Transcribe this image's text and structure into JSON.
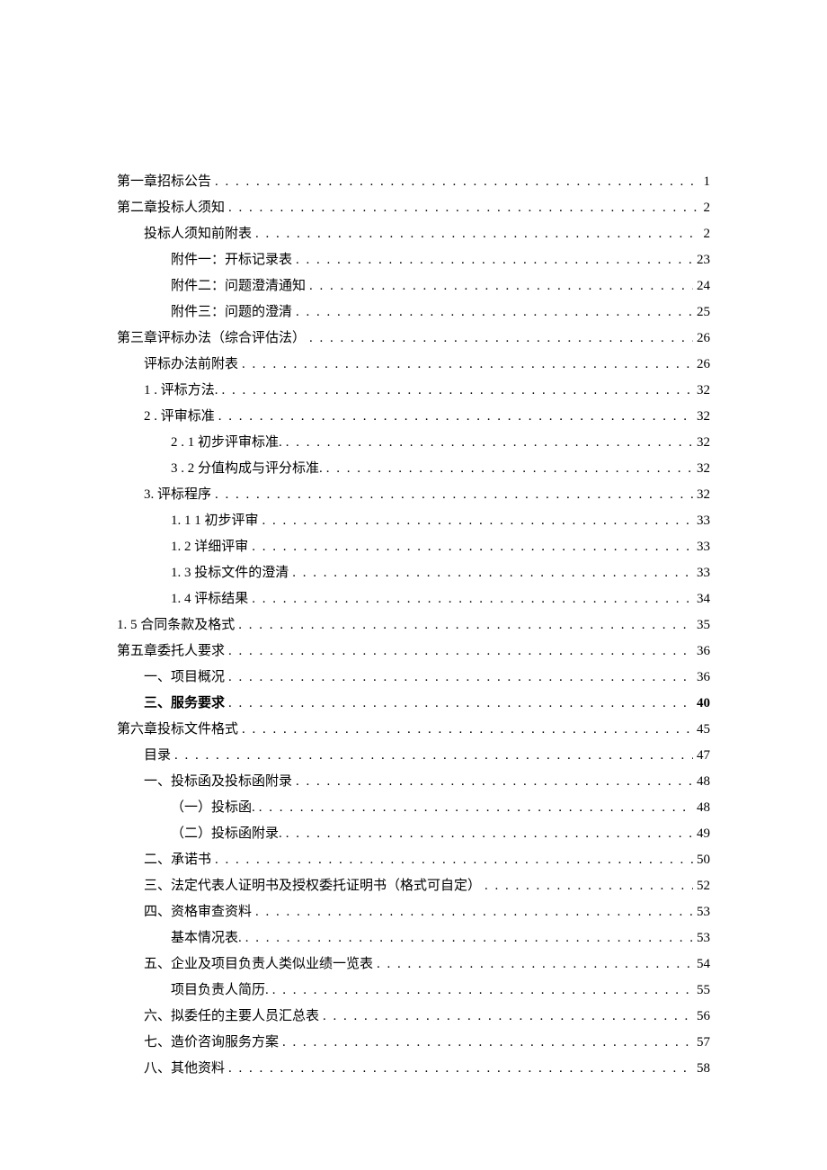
{
  "toc": [
    {
      "label": "第一章招标公告",
      "page": "1",
      "indent": 0
    },
    {
      "label": "第二章投标人须知",
      "page": "2",
      "indent": 0
    },
    {
      "label": "投标人须知前附表",
      "page": "2",
      "indent": 1
    },
    {
      "label": "附件一：开标记录表",
      "page": "23",
      "indent": 2
    },
    {
      "label": "附件二：问题澄清通知",
      "page": "24",
      "indent": 2
    },
    {
      "label": "附件三：问题的澄清",
      "page": "25",
      "indent": 2
    },
    {
      "label": "第三章评标办法（综合评估法）",
      "page": "26",
      "indent": 0
    },
    {
      "label": "评标办法前附表",
      "page": "26",
      "indent": 1
    },
    {
      "label": "1 . 评标方法.",
      "page": "32",
      "indent": 1
    },
    {
      "label": "2 . 评审标准",
      "page": "32",
      "indent": 1
    },
    {
      "label": "2 . 1 初步评审标准.",
      "page": "32",
      "indent": 2
    },
    {
      "label": "3 . 2 分值构成与评分标准.",
      "page": "32",
      "indent": 2
    },
    {
      "label": "3. 评标程序",
      "page": "32",
      "indent": 1
    },
    {
      "label": "1. 1 1 初步评审",
      "page": "33",
      "indent": 2
    },
    {
      "label": "1. 2  详细评审",
      "page": "33",
      "indent": 2
    },
    {
      "label": "1. 3  投标文件的澄清",
      "page": "33",
      "indent": 2
    },
    {
      "label": "1. 4  评标结果",
      "page": "34",
      "indent": 2
    },
    {
      "label": "1. 5    合同条款及格式",
      "page": "35",
      "indent": 0
    },
    {
      "label": "第五章委托人要求",
      "page": "36",
      "indent": 0
    },
    {
      "label": "一、项目概况",
      "page": "36",
      "indent": 1
    },
    {
      "label": "三、服务要求",
      "page": "40",
      "indent": 1,
      "bold": true
    },
    {
      "label": "第六章投标文件格式",
      "page": "45",
      "indent": 0
    },
    {
      "label": "目录",
      "page": "47",
      "indent": 1
    },
    {
      "label": "一、投标函及投标函附录",
      "page": "48",
      "indent": 1
    },
    {
      "label": "（一）投标函.",
      "page": "48",
      "indent": 2
    },
    {
      "label": "（二）投标函附录.",
      "page": "49",
      "indent": 2
    },
    {
      "label": "二、承诺书",
      "page": "50",
      "indent": 1
    },
    {
      "label": "三、法定代表人证明书及授权委托证明书（格式可自定）",
      "page": "52",
      "indent": 1
    },
    {
      "label": "四、资格审查资料",
      "page": "53",
      "indent": 1
    },
    {
      "label": "基本情况表.",
      "page": "53",
      "indent": 2
    },
    {
      "label": "五、企业及项目负责人类似业绩一览表",
      "page": "54",
      "indent": 1
    },
    {
      "label": "项目负责人简历.",
      "page": "55",
      "indent": 2
    },
    {
      "label": "六、拟委任的主要人员汇总表",
      "page": "56",
      "indent": 1
    },
    {
      "label": "七、造价咨询服务方案",
      "page": "57",
      "indent": 1
    },
    {
      "label": "八、其他资料",
      "page": "58",
      "indent": 1
    }
  ]
}
